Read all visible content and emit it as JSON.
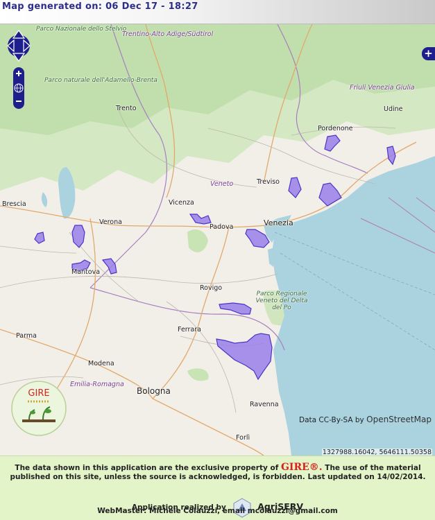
{
  "header": {
    "title": "Map generated on: 06 Dec 17 - 18:27"
  },
  "controls": {
    "pan_up_icon": "arrow-up-icon",
    "pan_left_icon": "arrow-left-icon",
    "pan_right_icon": "arrow-right-icon",
    "pan_down_icon": "arrow-down-icon",
    "zoom_in_icon": "plus-icon",
    "zoom_world_icon": "globe-icon",
    "zoom_out_icon": "minus-icon",
    "layer_switcher_label": "+"
  },
  "places": {
    "parco_stelvio": "Parco Nazionale dello Stelvio",
    "trentino": "Trentino-Alto Adige/Südtirol",
    "parco_adamello": "Parco naturale dell'Adamello-Brenta",
    "trento": "Trento",
    "friuli": "Friuli Venezia Giulia",
    "udine": "Udine",
    "pordenone": "Pordenone",
    "veneto": "Veneto",
    "treviso": "Treviso",
    "brescia": "Brescia",
    "vicenza": "Vicenza",
    "verona": "Verona",
    "padova": "Padova",
    "venezia": "Venezia",
    "mantova": "Mantova",
    "rovigo": "Rovigo",
    "parco_delta": "Parco Regionale Veneto del Delta del Po",
    "ferrara": "Ferrara",
    "parma": "Parma",
    "modena": "Modena",
    "emilia": "Emilia-Romagna",
    "bologna": "Bologna",
    "ravenna": "Ravenna",
    "forli": "Forlì"
  },
  "attribution": {
    "prefix": "Data CC-By-SA by",
    "source": "OpenStreetMap"
  },
  "mouse_position": "1327988.16042, 5646111.50358",
  "logo": {
    "text": "GIRE"
  },
  "footer": {
    "notice_part1": "The data shown in this application are the exclusive property of",
    "brand": "GIRE®.",
    "notice_part2": "The use of the material published on this site, unless the source is acknowledged, is forbidden. Last updated on 14/02/2014.",
    "realized_label": "Application realized by",
    "realized_company": "AgriSERV",
    "webmaster": "WebMaster: Michele Colauzzi, email mcolauzzi@gmail.com"
  },
  "colors": {
    "land": "#f2efe9",
    "sea": "#aad3df",
    "forest": "#c8e3b4",
    "highlight_fill": "#9a7fe9",
    "highlight_stroke": "#4a34c8",
    "control": "#1e1e8c",
    "footer_bg": "#e4f4c9"
  }
}
